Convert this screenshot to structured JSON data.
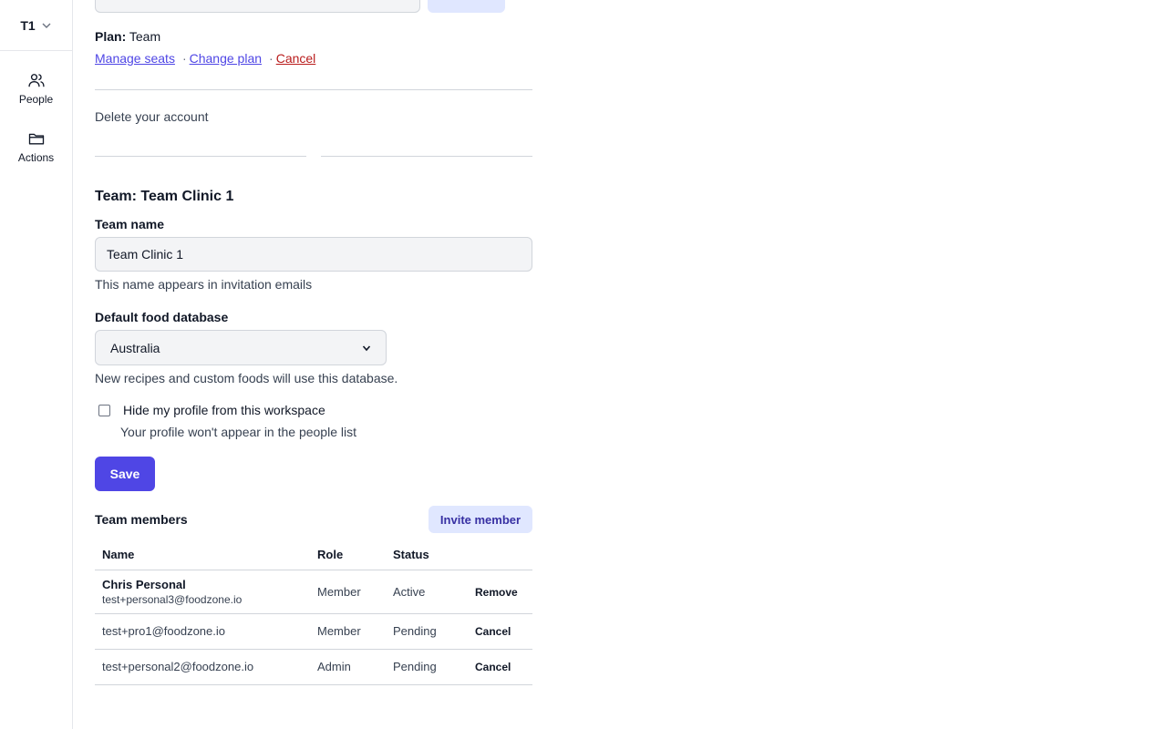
{
  "sidebar": {
    "workspace": "T1",
    "items": [
      {
        "label": "People",
        "icon": "people-icon"
      },
      {
        "label": "Actions",
        "icon": "folder-icon"
      }
    ]
  },
  "plan": {
    "label": "Plan:",
    "value": "Team",
    "links": {
      "manage_seats": "Manage seats",
      "change_plan": "Change plan",
      "cancel": "Cancel"
    },
    "separator": "·"
  },
  "delete_account": "Delete your account",
  "team": {
    "heading": "Team: Team Clinic 1",
    "name_label": "Team name",
    "name_value": "Team Clinic 1",
    "name_help": "This name appears in invitation emails",
    "db_label": "Default food database",
    "db_value": "Australia",
    "db_help": "New recipes and custom foods will use this database.",
    "hide_label": "Hide my profile from this workspace",
    "hide_help": "Your profile won't appear in the people list",
    "hide_checked": false,
    "save_label": "Save"
  },
  "members": {
    "title": "Team members",
    "invite_label": "Invite member",
    "columns": [
      "Name",
      "Role",
      "Status",
      ""
    ],
    "rows": [
      {
        "name": "Chris Personal",
        "email": "test+personal3@foodzone.io",
        "role": "Member",
        "status": "Active",
        "action": "Remove"
      },
      {
        "name": "",
        "email": "test+pro1@foodzone.io",
        "role": "Member",
        "status": "Pending",
        "action": "Cancel"
      },
      {
        "name": "",
        "email": "test+personal2@foodzone.io",
        "role": "Admin",
        "status": "Pending",
        "action": "Cancel"
      }
    ]
  },
  "colors": {
    "accent": "#4f46e5",
    "accent_light": "#e0e7ff",
    "danger": "#b91c1c",
    "border": "#d1d5db"
  }
}
